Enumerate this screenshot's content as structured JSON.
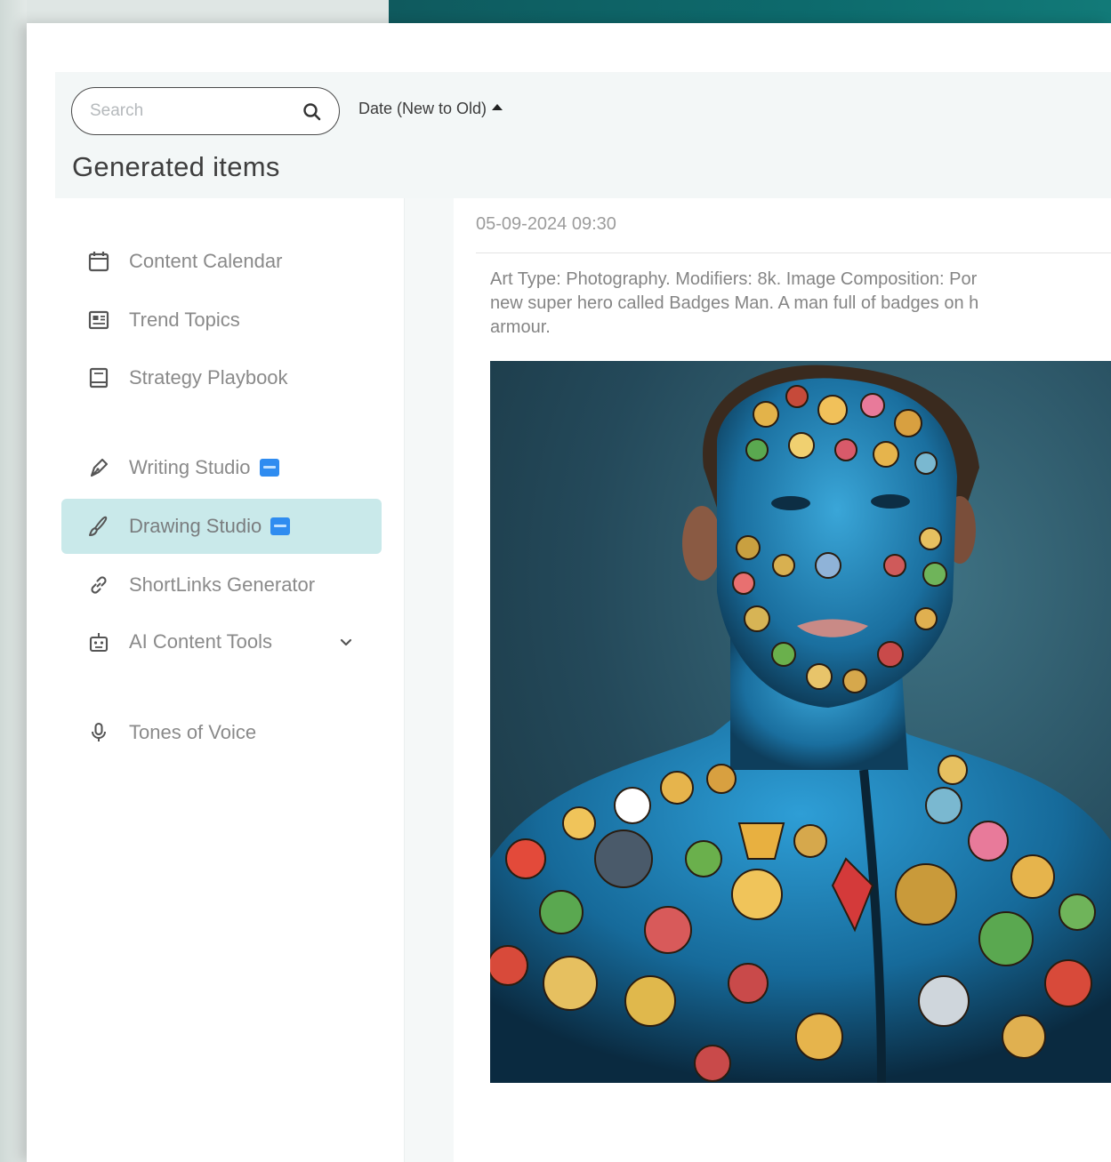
{
  "search": {
    "placeholder": "Search"
  },
  "sort": {
    "label": "Date (New to Old)"
  },
  "page_title": "Generated items",
  "sidebar": {
    "items": [
      {
        "label": "Content Calendar",
        "icon": "calendar-icon"
      },
      {
        "label": "Trend Topics",
        "icon": "newspaper-icon"
      },
      {
        "label": "Strategy Playbook",
        "icon": "book-icon"
      },
      {
        "label": "Writing Studio",
        "icon": "pen-nib-icon",
        "badge": "new-badge"
      },
      {
        "label": "Drawing Studio",
        "icon": "brush-icon",
        "badge": "new-badge",
        "active": true
      },
      {
        "label": "ShortLinks Generator",
        "icon": "link-icon"
      },
      {
        "label": "AI Content Tools",
        "icon": "robot-icon",
        "expandable": true
      },
      {
        "label": "Tones of Voice",
        "icon": "microphone-icon"
      }
    ]
  },
  "item": {
    "timestamp": "05-09-2024 09:30",
    "prompt_lines": [
      "Art Type: Photography. Modifiers: 8k. Image Composition: Por",
      "new super hero called Badges Man. A man full of badges on h",
      "armour."
    ],
    "image_alt": "generated-image"
  },
  "colors": {
    "accent": "#0d6b6d",
    "active_nav": "#c9e9ea",
    "badge_new": "#2f8cf0"
  }
}
